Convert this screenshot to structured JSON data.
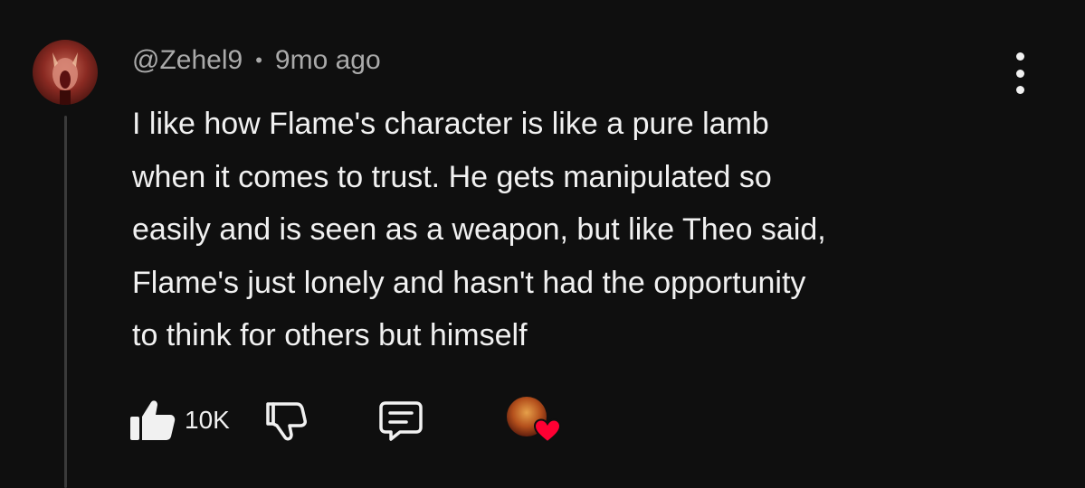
{
  "comment": {
    "author": "@Zehel9",
    "separator": "•",
    "time": "9mo ago",
    "text": "I like how Flame's character is like a pure lamb\nwhen it comes to trust. He gets manipulated so\neasily and is seen as a weapon, but like Theo said,\nFlame's just lonely and hasn't had the opportunity\nto think for others but himself",
    "like_count": "10K"
  },
  "icons": {
    "like": "thumbs-up-icon",
    "dislike": "thumbs-down-icon",
    "reply": "comment-icon",
    "menu": "more-vertical-icon",
    "heart": "heart-icon"
  },
  "colors": {
    "background": "#0f0f0f",
    "text": "#f1f1f1",
    "meta": "#aaaaaa",
    "heart": "#ff0033"
  }
}
